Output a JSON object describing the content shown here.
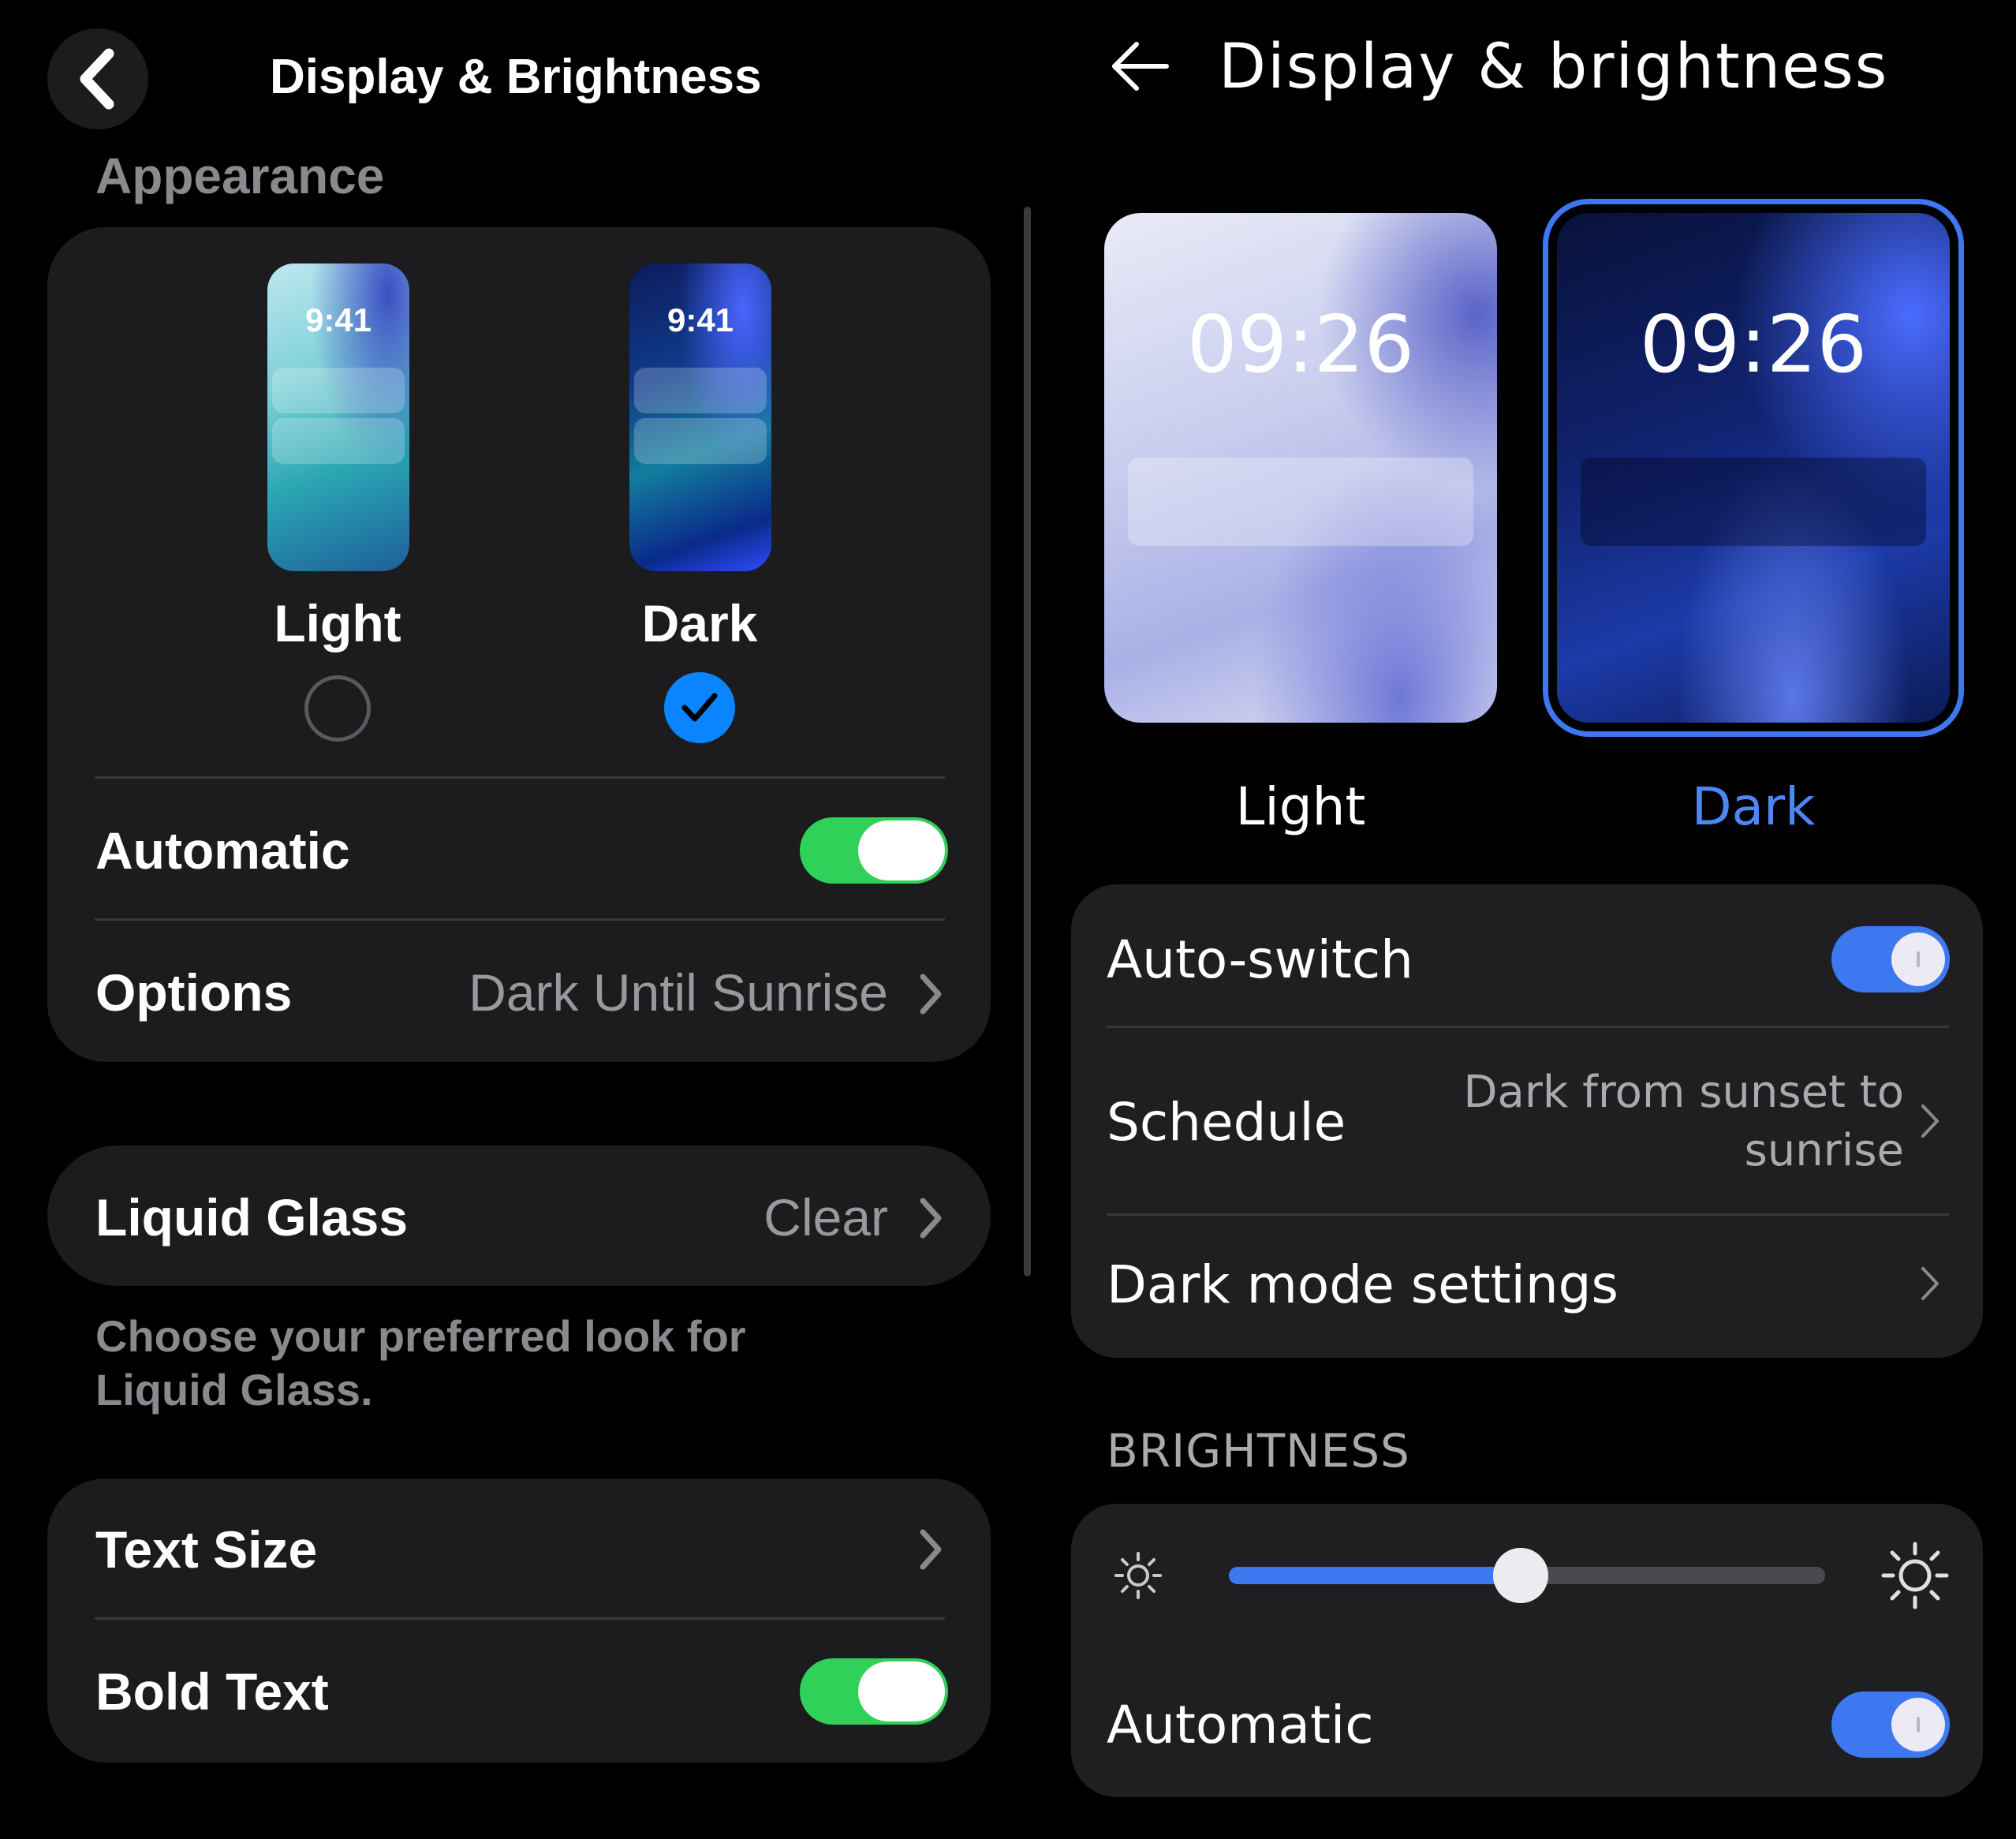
{
  "ios": {
    "title": "Display & Brightness",
    "section_appearance": "Appearance",
    "modes": [
      {
        "time": "9:41",
        "label": "Light",
        "selected": false
      },
      {
        "time": "9:41",
        "label": "Dark",
        "selected": true
      }
    ],
    "automatic": {
      "label": "Automatic",
      "on": true
    },
    "options": {
      "label": "Options",
      "value": "Dark Until Sunrise"
    },
    "liquid_glass": {
      "label": "Liquid Glass",
      "value": "Clear"
    },
    "liquid_glass_footnote": "Choose your preferred look for Liquid Glass.",
    "text_size": {
      "label": "Text Size"
    },
    "bold_text": {
      "label": "Bold Text",
      "on": true
    },
    "colors": {
      "toggle_on": "#30d158",
      "check_accent": "#0a84ff"
    }
  },
  "android": {
    "title": "Display & brightness",
    "modes": [
      {
        "time": "09:26",
        "label": "Light",
        "selected": false
      },
      {
        "time": "09:26",
        "label": "Dark",
        "selected": true
      }
    ],
    "auto_switch": {
      "label": "Auto-switch",
      "on": true
    },
    "schedule": {
      "label": "Schedule",
      "value_line1": "Dark from sunset to",
      "value_line2": "sunrise"
    },
    "dark_mode_settings": {
      "label": "Dark mode settings"
    },
    "section_brightness": "BRIGHTNESS",
    "brightness": {
      "level": 0.49
    },
    "automatic": {
      "label": "Automatic",
      "on": true
    },
    "colors": {
      "accent": "#3d78f0",
      "selected_label": "#4f86f7"
    }
  }
}
